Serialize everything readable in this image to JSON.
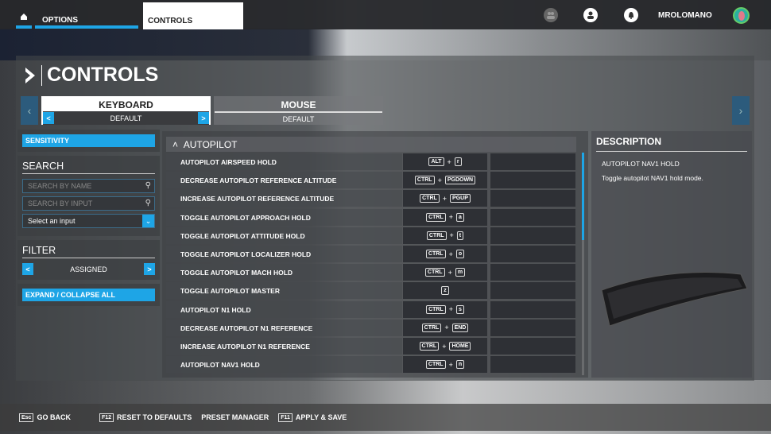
{
  "topbar": {
    "home_icon": "home-icon",
    "options": "OPTIONS",
    "controls_tab": "CONTROLS",
    "username": "MROLOMANO",
    "icons": [
      "friends-icon",
      "profile-icon",
      "notifications-icon"
    ]
  },
  "header": {
    "title": "CONTROLS"
  },
  "devices": [
    {
      "name": "KEYBOARD",
      "preset": "DEFAULT",
      "selected": true
    },
    {
      "name": "MOUSE",
      "preset": "DEFAULT",
      "selected": false
    }
  ],
  "sidebar": {
    "sensitivity": "SENSITIVITY",
    "search_title": "SEARCH",
    "search_name_placeholder": "SEARCH BY NAME",
    "search_input_placeholder": "SEARCH BY INPUT",
    "select_input": "Select an input",
    "filter_title": "FILTER",
    "filter_value": "ASSIGNED",
    "expand_collapse": "EXPAND / COLLAPSE ALL"
  },
  "list": {
    "section": "AUTOPILOT",
    "rows": [
      {
        "label": "AUTOPILOT AIRSPEED HOLD",
        "keys": [
          "ALT",
          "r"
        ]
      },
      {
        "label": "DECREASE AUTOPILOT REFERENCE ALTITUDE",
        "keys": [
          "CTRL",
          "PGDOWN"
        ]
      },
      {
        "label": "INCREASE AUTOPILOT REFERENCE ALTITUDE",
        "keys": [
          "CTRL",
          "PGUP"
        ]
      },
      {
        "label": "TOGGLE AUTOPILOT APPROACH HOLD",
        "keys": [
          "CTRL",
          "a"
        ]
      },
      {
        "label": "TOGGLE AUTOPILOT ATTITUDE HOLD",
        "keys": [
          "CTRL",
          "t"
        ]
      },
      {
        "label": "TOGGLE AUTOPILOT LOCALIZER HOLD",
        "keys": [
          "CTRL",
          "o"
        ]
      },
      {
        "label": "TOGGLE AUTOPILOT MACH HOLD",
        "keys": [
          "CTRL",
          "m"
        ]
      },
      {
        "label": "TOGGLE AUTOPILOT MASTER",
        "keys": [
          "z"
        ]
      },
      {
        "label": "AUTOPILOT N1 HOLD",
        "keys": [
          "CTRL",
          "s"
        ]
      },
      {
        "label": "DECREASE AUTOPILOT N1 REFERENCE",
        "keys": [
          "CTRL",
          "END"
        ]
      },
      {
        "label": "INCREASE AUTOPILOT N1 REFERENCE",
        "keys": [
          "CTRL",
          "HOME"
        ]
      },
      {
        "label": "AUTOPILOT NAV1 HOLD",
        "keys": [
          "CTRL",
          "n"
        ]
      }
    ]
  },
  "description": {
    "title": "DESCRIPTION",
    "item": "AUTOPILOT NAV1 HOLD",
    "text": "Toggle autopilot NAV1 hold mode."
  },
  "footer": [
    {
      "key": "Esc",
      "label": "GO BACK"
    },
    {
      "key": "F12",
      "label": "RESET TO DEFAULTS"
    },
    {
      "key": "",
      "label": "PRESET MANAGER"
    },
    {
      "key": "F11",
      "label": "APPLY & SAVE"
    }
  ],
  "colors": {
    "accent": "#1ea5e6"
  }
}
